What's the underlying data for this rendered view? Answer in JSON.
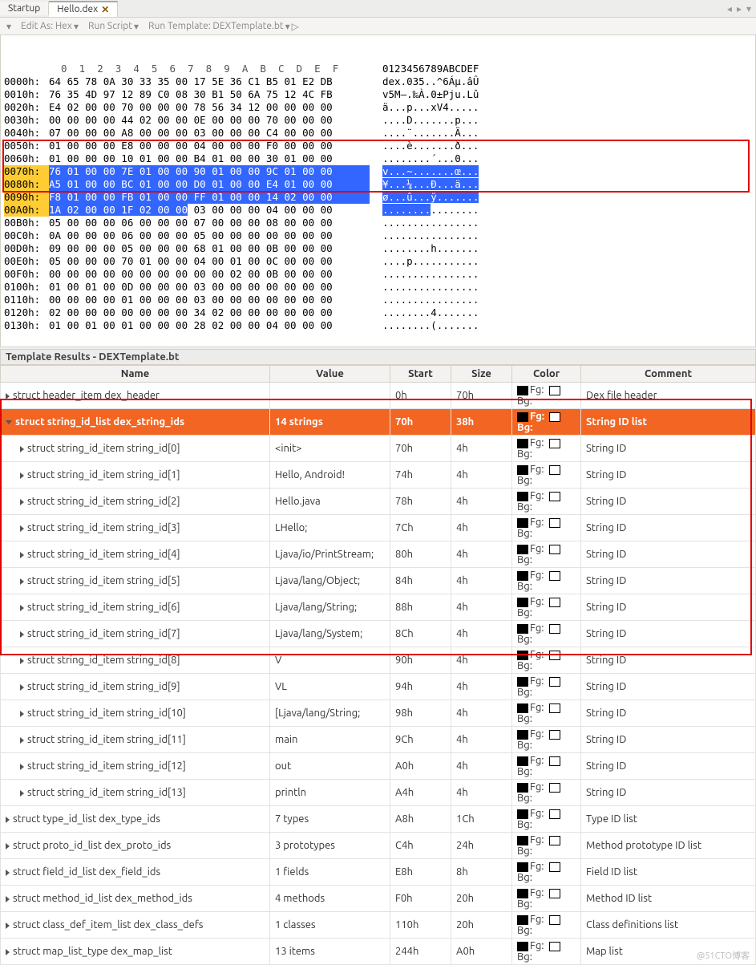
{
  "tabs": {
    "startup": "Startup",
    "hello": "Hello.dex"
  },
  "toolbar": {
    "edit_as": "Edit As: Hex",
    "run_script": "Run Script",
    "run_template": "Run Template: DEXTemplate.bt"
  },
  "hex": {
    "ruler_bytes": "  0  1  2  3  4  5  6  7  8  9  A  B  C  D  E  F",
    "ruler_ascii": "0123456789ABCDEF",
    "rows": [
      {
        "a": "0000h:",
        "b": "64 65 78 0A 30 33 35 00 17 5E 36 C1 B5 01 E2 DB",
        "t": "dex.035..^6Áµ.âÛ"
      },
      {
        "a": "0010h:",
        "b": "76 35 4D 97 12 89 C0 08 30 B1 50 6A 75 12 4C FB",
        "t": "v5M—.‰À.0±Pju.Lû"
      },
      {
        "a": "0020h:",
        "b": "E4 02 00 00 70 00 00 00 78 56 34 12 00 00 00 00",
        "t": "ä...p...xV4....."
      },
      {
        "a": "0030h:",
        "b": "00 00 00 00 44 02 00 00 0E 00 00 00 70 00 00 00",
        "t": "....D.......p..."
      },
      {
        "a": "0040h:",
        "b": "07 00 00 00 A8 00 00 00 03 00 00 00 C4 00 00 00",
        "t": "....¨.......Ä..."
      },
      {
        "a": "0050h:",
        "b": "01 00 00 00 E8 00 00 00 04 00 00 00 F0 00 00 00",
        "t": "....è.......ð..."
      },
      {
        "a": "0060h:",
        "b": "01 00 00 00 10 01 00 00 B4 01 00 00 30 01 00 00",
        "t": "........´...0..."
      }
    ],
    "sel_rows": [
      {
        "a": "0070h:",
        "b": "76 01 00 00 7E 01 00 00 90 01 00 00 9C 01 00 00",
        "t": "v...~.......œ..."
      },
      {
        "a": "0080h:",
        "b": "A5 01 00 00 BC 01 00 00 D0 01 00 00 E4 01 00 00",
        "t": "¥...¼...Ð...ä..."
      },
      {
        "a": "0090h:",
        "b": "F8 01 00 00 FB 01 00 00 FF 01 00 00 14 02 00 00",
        "t": "ø...û...ÿ......."
      },
      {
        "a": "00A0h:",
        "b_sel": "1A 02 00 00 1F 02 00 00",
        "b_rest": " 03 00 00 00 04 00 00 00",
        "t_sel": "........",
        "t_rest": "........"
      }
    ],
    "rows2": [
      {
        "a": "00B0h:",
        "b": "05 00 00 00 06 00 00 00 07 00 00 00 08 00 00 00",
        "t": "................"
      },
      {
        "a": "00C0h:",
        "b": "0A 00 00 00 06 00 00 00 05 00 00 00 00 00 00 00",
        "t": "................"
      },
      {
        "a": "00D0h:",
        "b": "09 00 00 00 05 00 00 00 68 01 00 00 0B 00 00 00",
        "t": "........h......."
      },
      {
        "a": "00E0h:",
        "b": "05 00 00 00 70 01 00 00 04 00 01 00 0C 00 00 00",
        "t": "....p..........."
      },
      {
        "a": "00F0h:",
        "b": "00 00 00 00 00 00 00 00 00 00 02 00 0B 00 00 00",
        "t": "................"
      },
      {
        "a": "0100h:",
        "b": "01 00 01 00 0D 00 00 00 03 00 00 00 00 00 00 00",
        "t": "................"
      },
      {
        "a": "0110h:",
        "b": "00 00 00 00 01 00 00 00 03 00 00 00 00 00 00 00",
        "t": "................"
      },
      {
        "a": "0120h:",
        "b": "02 00 00 00 00 00 00 00 34 02 00 00 00 00 00 00",
        "t": "........4......."
      },
      {
        "a": "0130h:",
        "b": "01 00 01 00 01 00 00 00 28 02 00 00 04 00 00 00",
        "t": "........(......."
      }
    ]
  },
  "section_title": "Template Results - DEXTemplate.bt",
  "cols": {
    "name": "Name",
    "value": "Value",
    "start": "Start",
    "size": "Size",
    "color": "Color",
    "comment": "Comment"
  },
  "clr": {
    "fg": "Fg:",
    "bg": "Bg:"
  },
  "rows": [
    {
      "ind": 0,
      "n": "struct header_item dex_header",
      "v": "",
      "s": "0h",
      "z": "70h",
      "c": "Dex file header"
    },
    {
      "ind": 0,
      "hi": true,
      "down": true,
      "n": "struct string_id_list dex_string_ids",
      "v": "14 strings",
      "s": "70h",
      "z": "38h",
      "c": "String ID list"
    },
    {
      "ind": 1,
      "n": "struct string_id_item string_id[0]",
      "v": "<init>",
      "s": "70h",
      "z": "4h",
      "c": "String ID"
    },
    {
      "ind": 1,
      "n": "struct string_id_item string_id[1]",
      "v": "Hello, Android!",
      "s": "74h",
      "z": "4h",
      "c": "String ID"
    },
    {
      "ind": 1,
      "n": "struct string_id_item string_id[2]",
      "v": "Hello.java",
      "s": "78h",
      "z": "4h",
      "c": "String ID"
    },
    {
      "ind": 1,
      "n": "struct string_id_item string_id[3]",
      "v": "LHello;",
      "s": "7Ch",
      "z": "4h",
      "c": "String ID"
    },
    {
      "ind": 1,
      "n": "struct string_id_item string_id[4]",
      "v": "Ljava/io/PrintStream;",
      "s": "80h",
      "z": "4h",
      "c": "String ID"
    },
    {
      "ind": 1,
      "n": "struct string_id_item string_id[5]",
      "v": "Ljava/lang/Object;",
      "s": "84h",
      "z": "4h",
      "c": "String ID"
    },
    {
      "ind": 1,
      "n": "struct string_id_item string_id[6]",
      "v": "Ljava/lang/String;",
      "s": "88h",
      "z": "4h",
      "c": "String ID"
    },
    {
      "ind": 1,
      "n": "struct string_id_item string_id[7]",
      "v": "Ljava/lang/System;",
      "s": "8Ch",
      "z": "4h",
      "c": "String ID"
    },
    {
      "ind": 1,
      "n": "struct string_id_item string_id[8]",
      "v": "V",
      "s": "90h",
      "z": "4h",
      "c": "String ID"
    },
    {
      "ind": 1,
      "n": "struct string_id_item string_id[9]",
      "v": "VL",
      "s": "94h",
      "z": "4h",
      "c": "String ID"
    },
    {
      "ind": 1,
      "n": "struct string_id_item string_id[10]",
      "v": "[Ljava/lang/String;",
      "s": "98h",
      "z": "4h",
      "c": "String ID"
    },
    {
      "ind": 1,
      "n": "struct string_id_item string_id[11]",
      "v": "main",
      "s": "9Ch",
      "z": "4h",
      "c": "String ID"
    },
    {
      "ind": 1,
      "n": "struct string_id_item string_id[12]",
      "v": "out",
      "s": "A0h",
      "z": "4h",
      "c": "String ID"
    },
    {
      "ind": 1,
      "n": "struct string_id_item string_id[13]",
      "v": "println",
      "s": "A4h",
      "z": "4h",
      "c": "String ID"
    },
    {
      "ind": 0,
      "n": "struct type_id_list dex_type_ids",
      "v": "7 types",
      "s": "A8h",
      "z": "1Ch",
      "c": "Type ID list"
    },
    {
      "ind": 0,
      "n": "struct proto_id_list dex_proto_ids",
      "v": "3 prototypes",
      "s": "C4h",
      "z": "24h",
      "c": "Method prototype ID list"
    },
    {
      "ind": 0,
      "n": "struct field_id_list dex_field_ids",
      "v": "1 fields",
      "s": "E8h",
      "z": "8h",
      "c": "Field ID list"
    },
    {
      "ind": 0,
      "n": "struct method_id_list dex_method_ids",
      "v": "4 methods",
      "s": "F0h",
      "z": "20h",
      "c": "Method ID list"
    },
    {
      "ind": 0,
      "n": "struct class_def_item_list dex_class_defs",
      "v": "1 classes",
      "s": "110h",
      "z": "20h",
      "c": "Class definitions list"
    },
    {
      "ind": 0,
      "n": "struct map_list_type dex_map_list",
      "v": "13 items",
      "s": "244h",
      "z": "A0h",
      "c": "Map list"
    }
  ],
  "watermark": "@51CTO博客"
}
